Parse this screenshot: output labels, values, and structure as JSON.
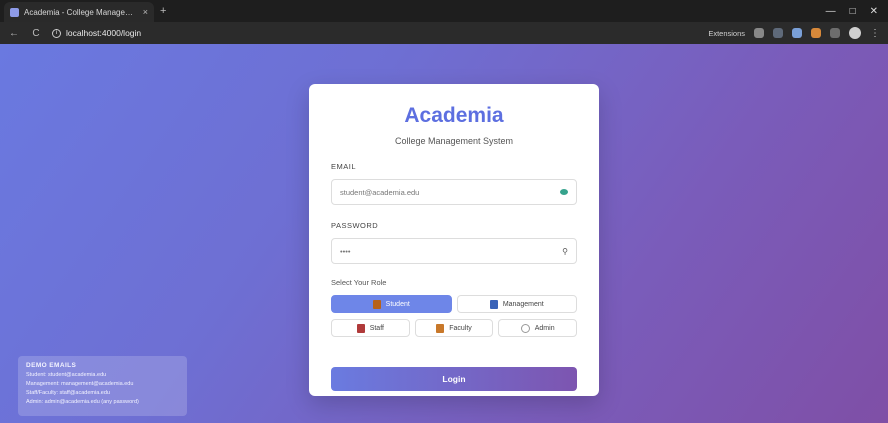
{
  "browser": {
    "tab_title": "Academia - College Management",
    "tab_close": "×",
    "new_tab": "+",
    "url": "localhost:4000/login",
    "extensions_label": "Extensions",
    "window_controls": {
      "minimize": "—",
      "maximize": "□",
      "close": "✕"
    },
    "nav": {
      "back": "←",
      "forward": "→",
      "reload": "C"
    }
  },
  "card": {
    "brand": "Academia",
    "subtitle": "College Management System",
    "email_label": "EMAIL",
    "email_value": "student@academia.edu",
    "password_label": "PASSWORD",
    "password_value": "••••",
    "role_label": "Select Your Role",
    "roles": [
      {
        "label": "Student",
        "active": true
      },
      {
        "label": "Management",
        "active": false
      },
      {
        "label": "Staff",
        "active": false
      },
      {
        "label": "Faculty",
        "active": false
      },
      {
        "label": "Admin",
        "active": false
      }
    ],
    "login_label": "Login",
    "show_password_icon": "⚲"
  },
  "demo": {
    "title": "DEMO EMAILS",
    "lines": [
      "Student: student@academia.edu",
      "Management: management@academia.edu",
      "Staff/Faculty: staff@academia.edu",
      "Admin: admin@academia.edu (any password)"
    ]
  },
  "colors": {
    "accent": "#5d6fe0",
    "bg_start": "#6a79e0",
    "bg_end": "#7f4fa6"
  }
}
